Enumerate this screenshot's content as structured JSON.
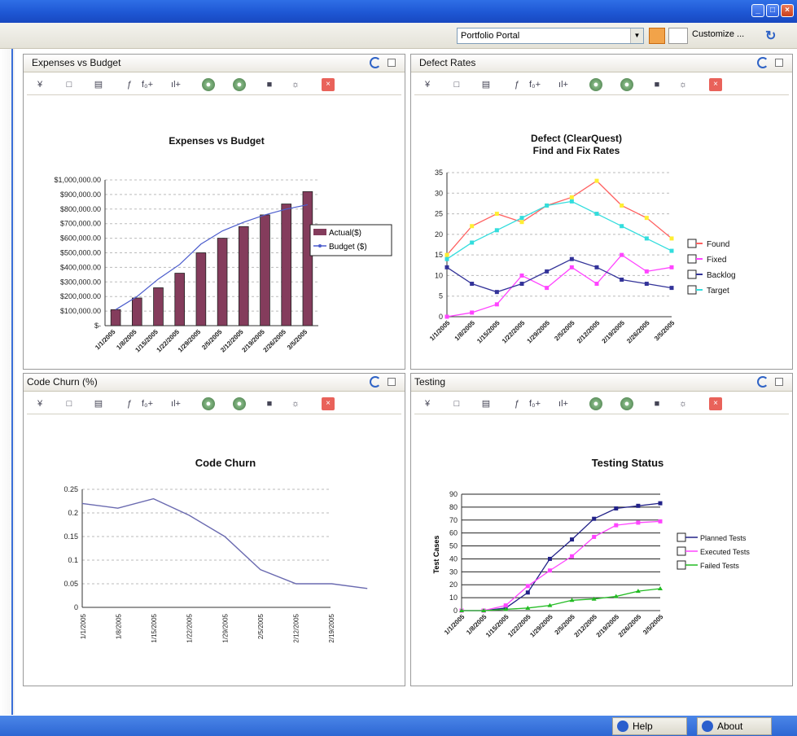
{
  "window": {
    "min": "_",
    "max": "□",
    "close": "×"
  },
  "top_toolbar": {
    "portal_select": "Portfolio Portal",
    "customize_label": "Customize ..."
  },
  "panels": {
    "expenses": {
      "title": "Expenses vs Budget"
    },
    "defects": {
      "title": "Defect Rates"
    },
    "churn": {
      "title": "Code Churn (%)"
    },
    "testing": {
      "title": "Testing"
    }
  },
  "panel_toolbar": [
    "¥",
    "□",
    "▤",
    "ƒ",
    "f₀+",
    "ıl+",
    "●",
    "●",
    "■",
    "☼",
    "×"
  ],
  "bottom": {
    "help": "Help",
    "about": "About"
  },
  "chart_data": [
    {
      "type": "bar",
      "title": "Expenses vs Budget",
      "categories": [
        "1/1/2005",
        "1/8/2005",
        "1/15/2005",
        "1/22/2005",
        "1/29/2005",
        "2/5/2005",
        "2/12/2005",
        "2/19/2005",
        "2/26/2005",
        "3/5/2005"
      ],
      "series": [
        {
          "name": "Actual($)",
          "type": "bar",
          "values": [
            110000,
            190000,
            260000,
            360000,
            500000,
            600000,
            680000,
            760000,
            835000,
            920000
          ],
          "color": "#843c5c"
        },
        {
          "name": "Budget ($)",
          "type": "line",
          "values": [
            110000,
            200000,
            320000,
            420000,
            560000,
            650000,
            710000,
            760000,
            800000,
            830000
          ],
          "color": "#4b5ccc"
        }
      ],
      "y_ticks": [
        "$1,000,000.00",
        "$900,000.00",
        "$800,000.00",
        "$700,000.00",
        "$600,000.00",
        "$500,000.00",
        "$400,000.00",
        "$300,000.00",
        "$200,000.00",
        "$100,000.00",
        "$-"
      ],
      "ylim": [
        0,
        1000000
      ],
      "legend": "right"
    },
    {
      "type": "line",
      "title": "Defect (ClearQuest)",
      "subtitle": "Find and Fix Rates",
      "categories": [
        "1/1/2005",
        "1/8/2005",
        "1/15/2005",
        "1/22/2005",
        "1/29/2005",
        "2/5/2005",
        "2/12/2005",
        "2/19/2005",
        "2/26/2005",
        "3/5/2005"
      ],
      "series": [
        {
          "name": "Found",
          "values": [
            15,
            22,
            25,
            23,
            27,
            29,
            33,
            27,
            24,
            19
          ],
          "color": "#ff6060",
          "marker": "#ffee33"
        },
        {
          "name": "Fixed",
          "values": [
            0,
            1,
            3,
            10,
            7,
            12,
            8,
            15,
            11,
            12
          ],
          "color": "#ff44ff",
          "marker": "#ff44ff"
        },
        {
          "name": "Backlog",
          "values": [
            12,
            8,
            6,
            8,
            11,
            14,
            12,
            9,
            8,
            7
          ],
          "color": "#333399",
          "marker": "#333399"
        },
        {
          "name": "Target",
          "values": [
            14,
            18,
            21,
            24,
            27,
            28,
            25,
            22,
            19,
            16
          ],
          "color": "#33dddd",
          "marker": "#33dddd"
        }
      ],
      "y_ticks": [
        "35",
        "30",
        "25",
        "20",
        "15",
        "10",
        "5",
        "0"
      ],
      "ylim": [
        0,
        35
      ],
      "legend": "right"
    },
    {
      "type": "line",
      "title": "Code Churn",
      "categories": [
        "1/1/2005",
        "1/8/2005",
        "1/15/2005",
        "1/22/2005",
        "1/29/2005",
        "2/5/2005",
        "2/12/2005",
        "2/19/2005"
      ],
      "series": [
        {
          "name": "",
          "values": [
            0.22,
            0.21,
            0.23,
            0.195,
            0.15,
            0.08,
            0.05,
            0.05,
            0.04
          ],
          "color": "#6a6ab0"
        }
      ],
      "y_ticks": [
        "0.25",
        "0.2",
        "0.15",
        "0.1",
        "0.05",
        "0"
      ],
      "ylim": [
        0,
        0.25
      ]
    },
    {
      "type": "line",
      "title": "Testing Status",
      "ylabel": "Test Cases",
      "categories": [
        "1/1/2005",
        "1/8/2005",
        "1/15/2005",
        "1/22/2005",
        "1/29/2005",
        "2/5/2005",
        "2/12/2005",
        "2/19/2005",
        "2/26/2005",
        "3/5/2005"
      ],
      "series": [
        {
          "name": "Planned Tests",
          "values": [
            0,
            0,
            2,
            14,
            40,
            55,
            71,
            79,
            81,
            83
          ],
          "color": "#222288",
          "marker": "#222288"
        },
        {
          "name": "Executed Tests",
          "values": [
            0,
            0,
            4,
            19,
            31,
            42,
            57,
            66,
            68,
            69
          ],
          "color": "#ff44ff",
          "marker": "#ff44ff"
        },
        {
          "name": "Failed Tests",
          "values": [
            0,
            0,
            1,
            2,
            4,
            8,
            9,
            11,
            15,
            17
          ],
          "color": "#22bb22",
          "marker": "#22bb22"
        }
      ],
      "y_ticks": [
        "90",
        "80",
        "70",
        "60",
        "50",
        "40",
        "30",
        "20",
        "10",
        "0"
      ],
      "ylim": [
        0,
        90
      ],
      "legend": "right"
    }
  ]
}
